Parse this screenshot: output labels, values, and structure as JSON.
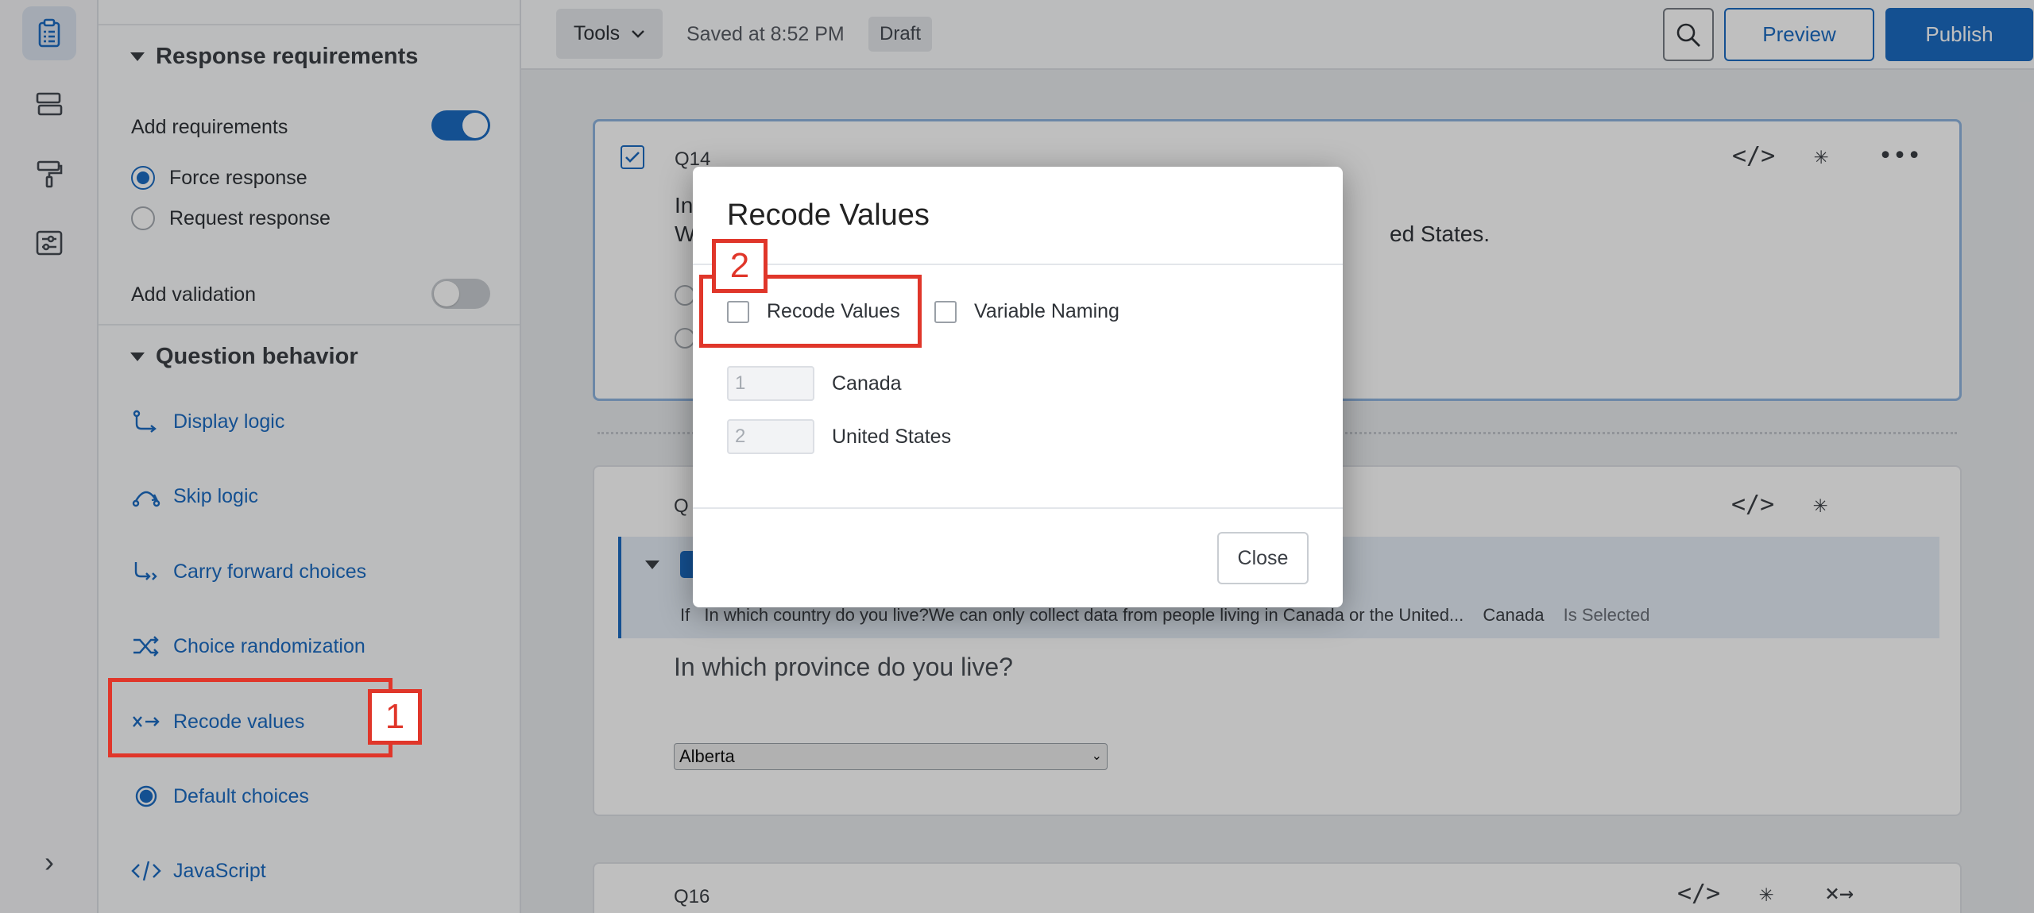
{
  "rail": {
    "items": [
      {
        "icon": "survey-clipboard-icon",
        "active": true
      },
      {
        "icon": "blocks-layout-icon",
        "active": false
      },
      {
        "icon": "paint-roller-icon",
        "active": false
      },
      {
        "icon": "survey-options-icon",
        "active": false
      }
    ],
    "expand_icon": "chevron-right-icon",
    "expand_glyph": "›"
  },
  "panel": {
    "response_requirements": {
      "title": "Response requirements",
      "add_requirements_label": "Add requirements",
      "add_requirements_on": true,
      "force_response_label": "Force response",
      "request_response_label": "Request response",
      "selected": "Force response",
      "add_validation_label": "Add validation",
      "add_validation_on": false
    },
    "question_behavior": {
      "title": "Question behavior",
      "items": [
        {
          "label": "Display logic",
          "icon": "display-logic-icon"
        },
        {
          "label": "Skip logic",
          "icon": "skip-logic-icon"
        },
        {
          "label": "Carry forward choices",
          "icon": "carry-forward-icon"
        },
        {
          "label": "Choice randomization",
          "icon": "shuffle-icon"
        },
        {
          "label": "Recode values",
          "icon": "recode-icon"
        },
        {
          "label": "Default choices",
          "icon": "default-choice-icon"
        },
        {
          "label": "JavaScript",
          "icon": "code-icon"
        }
      ]
    }
  },
  "topbar": {
    "tools_label": "Tools",
    "saved_text": "Saved at 8:52 PM",
    "draft_badge": "Draft",
    "preview_label": "Preview",
    "publish_label": "Publish"
  },
  "questions": {
    "q14": {
      "number": "Q14",
      "text_line1_start": "In",
      "text_line2_start": "W",
      "text_line2_end": "ed States."
    },
    "q15": {
      "number_prefix": "Q",
      "display_logic": {
        "if_label": "If",
        "condition": "In which country do you live?We can only collect data from people living in Canada or the United...",
        "value": "Canada",
        "operator": "Is Selected"
      },
      "text": "In which province do you live?",
      "select_value": "Alberta"
    },
    "q16": {
      "number": "Q16"
    },
    "tool_glyphs": {
      "code": "</>",
      "required": "✳",
      "more": "•••",
      "recode": "×→"
    }
  },
  "modal": {
    "title": "Recode Values",
    "recode_values_label": "Recode Values",
    "variable_naming_label": "Variable Naming",
    "rows": [
      {
        "value": "1",
        "label": "Canada"
      },
      {
        "value": "2",
        "label": "United States"
      }
    ],
    "close_label": "Close"
  },
  "annotations": {
    "step1": "1",
    "step2": "2",
    "color": "#e0362a"
  },
  "colors": {
    "accent": "#1b6bc2",
    "panel_bg": "#fafbfc",
    "canvas_bg": "#e9ebee"
  }
}
